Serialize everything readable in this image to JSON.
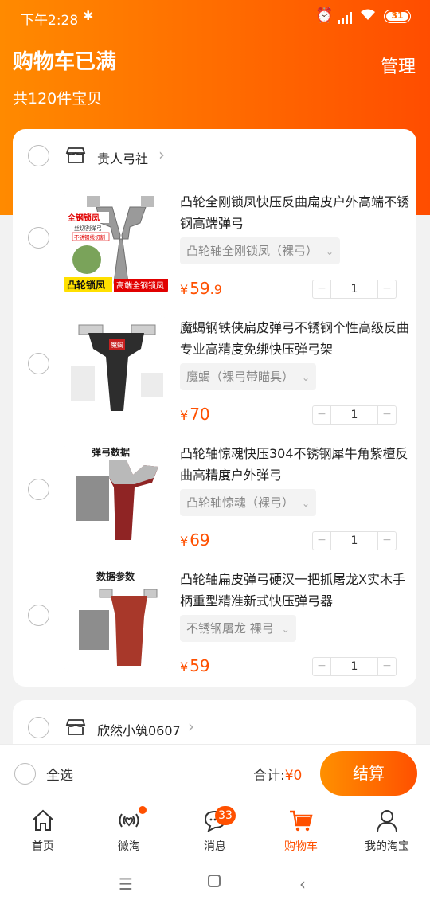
{
  "status_bar": {
    "time": "下午2:28",
    "battery": "31"
  },
  "header": {
    "title": "购物车已满",
    "manage_label": "管理",
    "count_label": "共120件宝贝"
  },
  "shops": [
    {
      "name": "贵人弓社",
      "items": [
        {
          "title": "凸轮全刚锁凤快压反曲扁皮户外高端不锈钢高端弹弓",
          "sku": "凸轮轴全刚锁凤（裸弓）",
          "price_int": "59",
          "price_dec": ".9",
          "qty": "1",
          "img_text": [
            "全钢锁凤",
            "丝切割弹弓",
            "不锈钢线切割",
            "凸轮锁凤",
            "高端全钢锁凤"
          ]
        },
        {
          "title": "魔蝎钢铁侠扁皮弹弓不锈钢个性高级反曲专业高精度免绑快压弹弓架",
          "sku": "魔蝎（裸弓带瞄具）",
          "price_int": "70",
          "price_dec": "",
          "qty": "1",
          "img_text": [
            "魔蝎"
          ]
        },
        {
          "title": "凸轮轴惊魂快压304不锈钢犀牛角紫檀反曲高精度户外弹弓",
          "sku": "凸轮轴惊魂（裸弓）",
          "price_int": "69",
          "price_dec": "",
          "qty": "1",
          "img_text": [
            "弹弓数据"
          ]
        },
        {
          "title": "凸轮轴扁皮弹弓硬汉一把抓屠龙X实木手柄重型精准新式快压弹弓器",
          "sku": "不锈钢屠龙  裸弓",
          "price_int": "59",
          "price_dec": "",
          "qty": "1",
          "img_text": [
            "数据参数"
          ]
        }
      ]
    },
    {
      "name": "欣然小筑0607",
      "items": []
    }
  ],
  "footer": {
    "select_all_label": "全选",
    "total_label": "合计:",
    "total_amount": "¥0",
    "checkout_label": "结算"
  },
  "currency": "¥",
  "tabs": [
    {
      "label": "首页",
      "icon": "home-icon"
    },
    {
      "label": "微淘",
      "icon": "weitao-icon"
    },
    {
      "label": "消息",
      "icon": "message-icon",
      "badge": "33"
    },
    {
      "label": "购物车",
      "icon": "cart-icon",
      "active": true
    },
    {
      "label": "我的淘宝",
      "icon": "profile-icon"
    }
  ],
  "colors": {
    "accent": "#ff5000",
    "header_start": "#ff8a00",
    "header_end": "#ff4d00"
  }
}
